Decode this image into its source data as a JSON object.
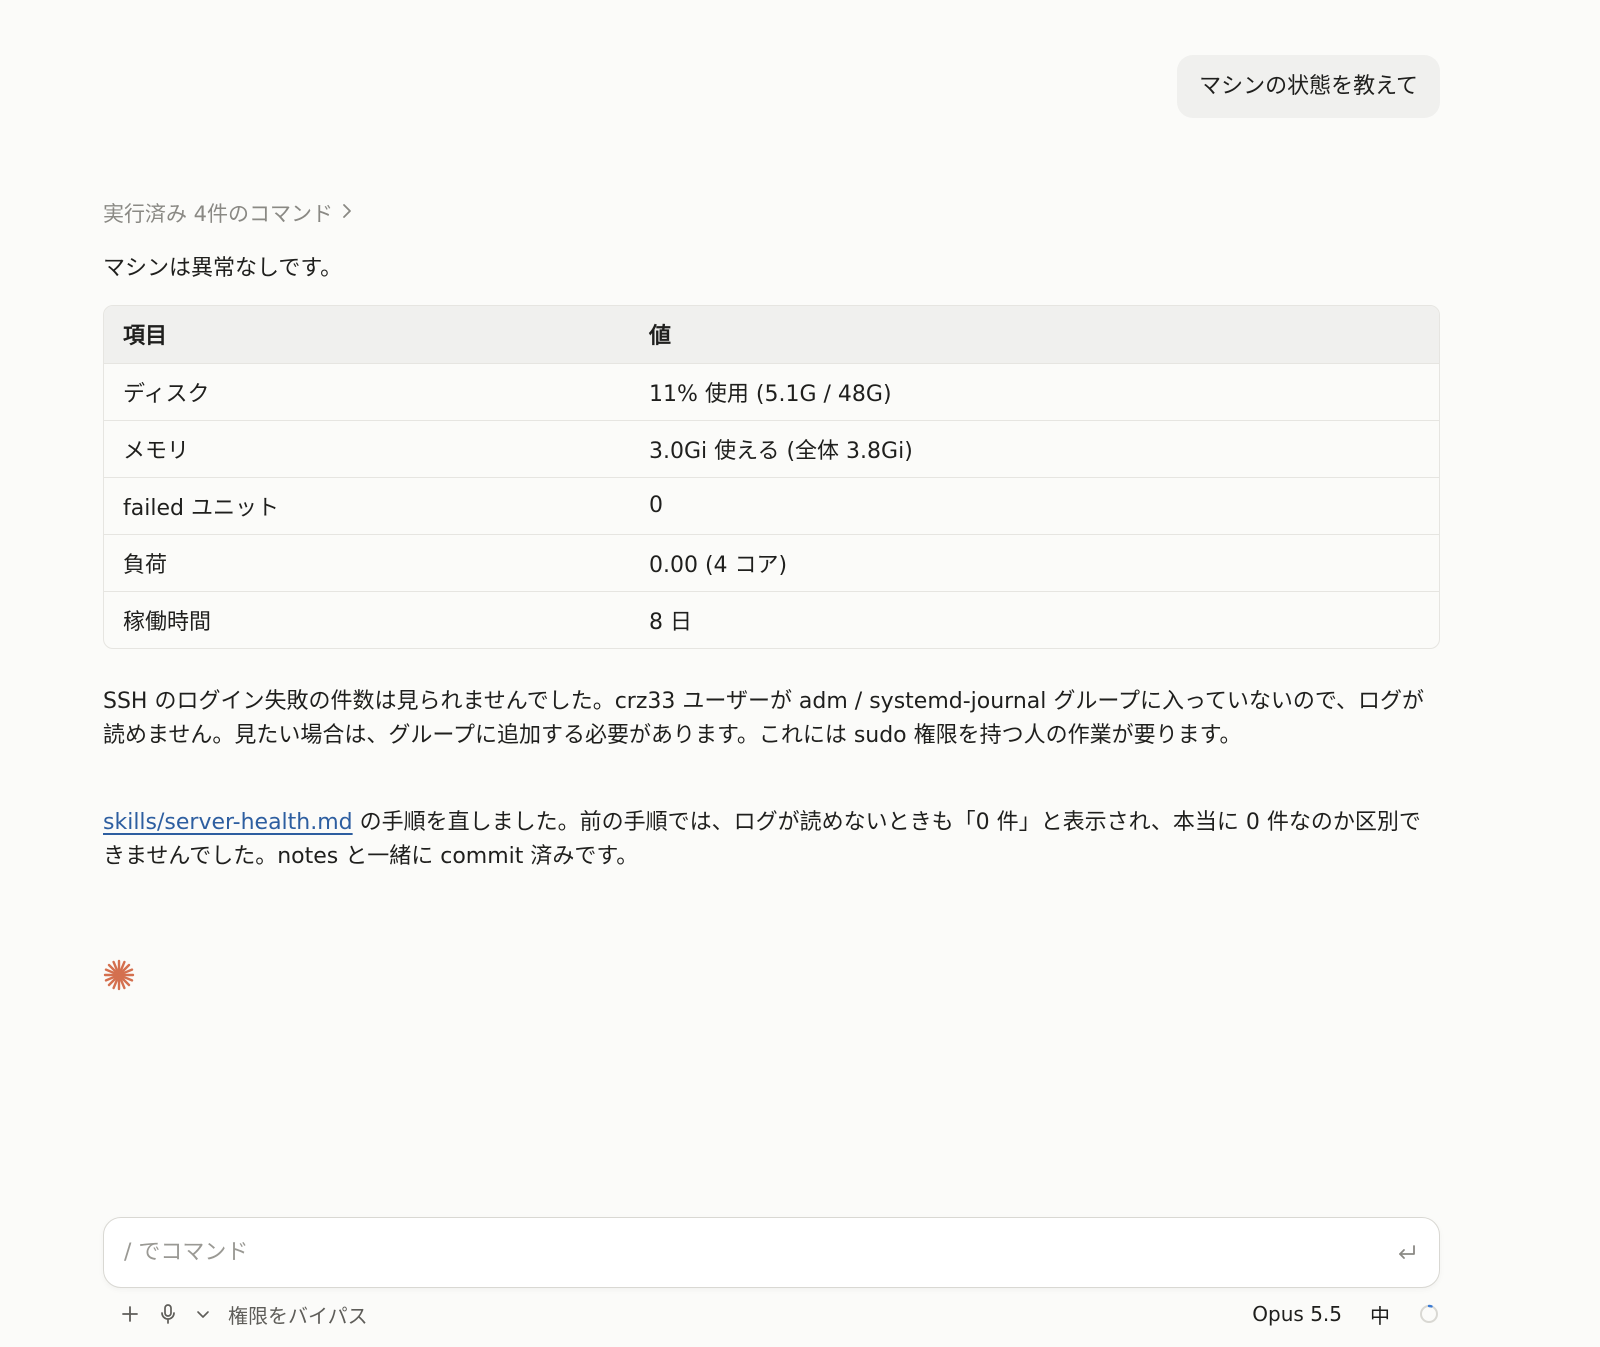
{
  "user_message": "マシンの状態を教えて",
  "commands_summary": "実行済み 4件のコマンド",
  "intro": "マシンは異常なしです。",
  "table": {
    "headers": [
      "項目",
      "値"
    ],
    "rows": [
      [
        "ディスク",
        "11% 使用 (5.1G / 48G)"
      ],
      [
        "メモリ",
        "3.0Gi 使える (全体 3.8Gi)"
      ],
      [
        "failed ユニット",
        "0"
      ],
      [
        "負荷",
        "0.00 (4 コア)"
      ],
      [
        "稼働時間",
        "8 日"
      ]
    ]
  },
  "paragraph1": "SSH のログイン失敗の件数は見られませんでした。crz33 ユーザーが adm / systemd-journal グループに入っていないので、ログが読めません。見たい場合は、グループに追加する必要があります。これには sudo 権限を持つ人の作業が要ります。",
  "paragraph2": {
    "link": "skills/server-health.md",
    "text": " の手順を直しました。前の手順では、ログが読めないときも「0 件」と表示され、本当に 0 件なのか区別できませんでした。notes と一緒に commit 済みです。"
  },
  "composer": {
    "placeholder": "/ でコマンド"
  },
  "toolbar": {
    "permission_mode": "権限をバイパス",
    "model": "Opus 5.5",
    "effort": "中"
  },
  "colors": {
    "accent": "#d4704f",
    "link": "#2d5ea0"
  }
}
